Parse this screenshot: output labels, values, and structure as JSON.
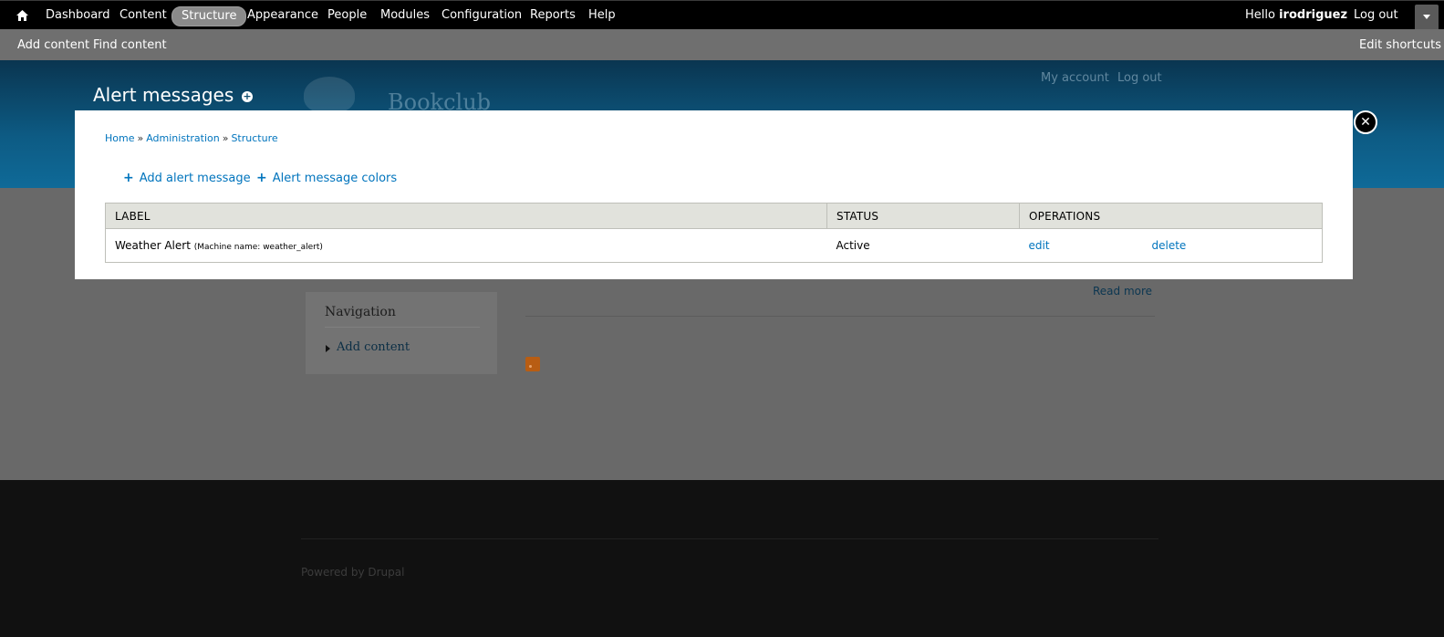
{
  "toolbar": {
    "home_icon": "home-icon",
    "menu": [
      {
        "label": "Dashboard"
      },
      {
        "label": "Content"
      },
      {
        "label": "Structure",
        "active": true
      },
      {
        "label": "Appearance"
      },
      {
        "label": "People"
      },
      {
        "label": "Modules"
      },
      {
        "label": "Configuration"
      },
      {
        "label": "Reports"
      },
      {
        "label": "Help"
      }
    ],
    "greeting": "Hello",
    "username": "irodriguez",
    "logout": "Log out"
  },
  "shortcuts": {
    "items": [
      "Add content",
      "Find content"
    ],
    "edit": "Edit shortcuts"
  },
  "site": {
    "page_title": "Alert messages",
    "name": "Bookclub",
    "header_links": [
      "My account",
      "Log out"
    ]
  },
  "background_page": {
    "read_more": "Read more",
    "nav_block": {
      "title": "Navigation",
      "items": [
        "Add content"
      ]
    },
    "footer": "Powered by Drupal"
  },
  "overlay": {
    "close_label": "✕",
    "breadcrumb": [
      "Home",
      "Administration",
      "Structure"
    ],
    "breadcrumb_sep": "»",
    "actions": [
      "Add alert message",
      "Alert message colors"
    ],
    "table": {
      "headers": [
        "LABEL",
        "STATUS",
        "OPERATIONS"
      ],
      "rows": [
        {
          "label": "Weather Alert",
          "machine_name": "(Machine name: weather_alert)",
          "status": "Active",
          "ops": [
            "edit",
            "delete"
          ]
        }
      ]
    }
  },
  "colors": {
    "link": "#0074bd",
    "toolbar": "#000000",
    "shortcuts_bar": "#6f6f6f",
    "table_header": "#e1e2dc"
  }
}
